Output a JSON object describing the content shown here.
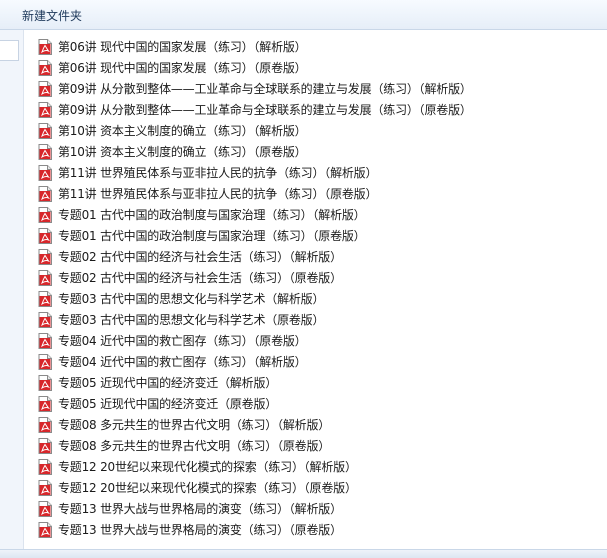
{
  "window": {
    "title": "新建文件夹"
  },
  "icons": {
    "file_icon": "pdf-file-icon",
    "accent": "#d7262a"
  },
  "files": [
    "第06讲 现代中国的国家发展（练习）（解析版）",
    "第06讲 现代中国的国家发展（练习）（原卷版）",
    "第09讲 从分散到整体——工业革命与全球联系的建立与发展（练习）（解析版）",
    "第09讲 从分散到整体——工业革命与全球联系的建立与发展（练习）（原卷版）",
    "第10讲 资本主义制度的确立（练习）（解析版）",
    "第10讲 资本主义制度的确立（练习）（原卷版）",
    "第11讲 世界殖民体系与亚非拉人民的抗争（练习）（解析版）",
    "第11讲 世界殖民体系与亚非拉人民的抗争（练习）（原卷版）",
    "专题01 古代中国的政治制度与国家治理（练习）（解析版）",
    "专题01 古代中国的政治制度与国家治理（练习）（原卷版）",
    "专题02 古代中国的经济与社会生活（练习）（解析版）",
    "专题02 古代中国的经济与社会生活（练习）（原卷版）",
    "专题03 古代中国的思想文化与科学艺术（解析版）",
    "专题03 古代中国的思想文化与科学艺术（原卷版）",
    "专题04  近代中国的救亡图存（练习）（原卷版）",
    "专题04 近代中国的救亡图存（练习）（解析版）",
    "专题05 近现代中国的经济变迁（解析版）",
    "专题05 近现代中国的经济变迁（原卷版）",
    "专题08 多元共生的世界古代文明（练习）（解析版）",
    "专题08 多元共生的世界古代文明（练习）（原卷版）",
    "专题12 20世纪以来现代化模式的探索（练习）（解析版）",
    "专题12 20世纪以来现代化模式的探索（练习）（原卷版）",
    "专题13 世界大战与世界格局的演变（练习）（解析版）",
    "专题13 世界大战与世界格局的演变（练习）（原卷版）"
  ]
}
